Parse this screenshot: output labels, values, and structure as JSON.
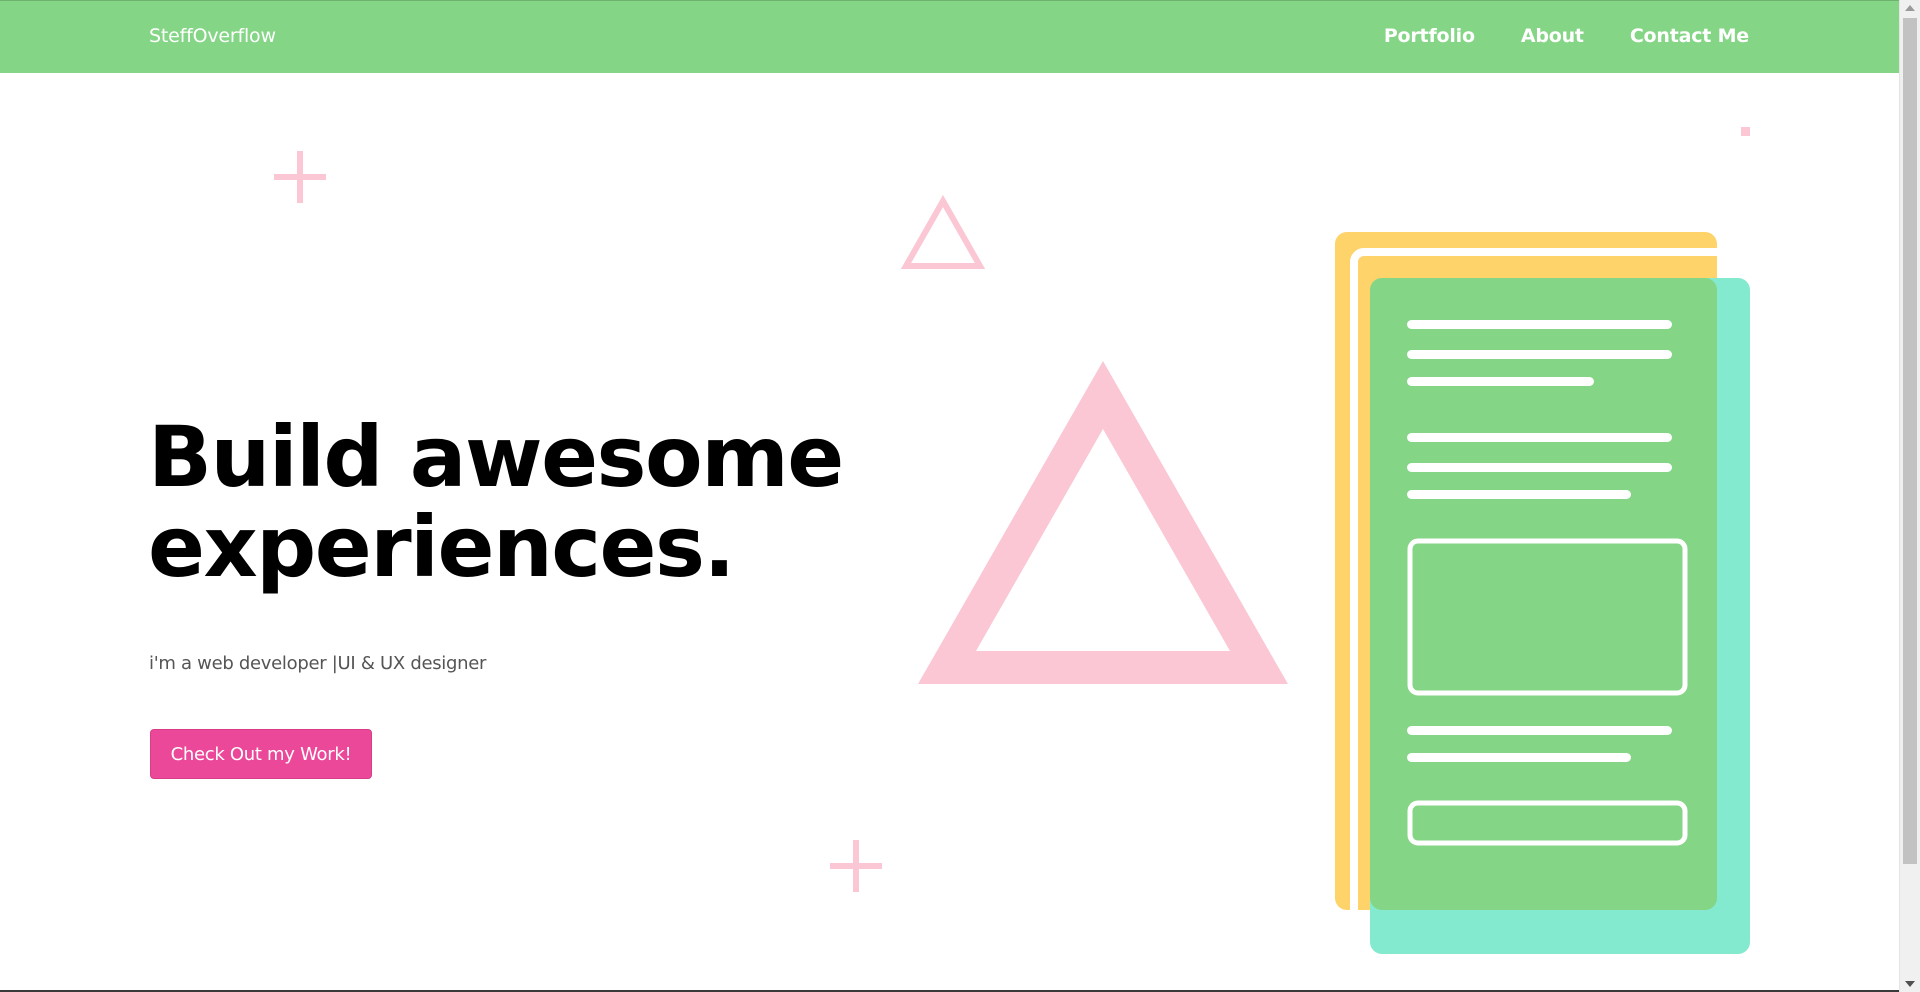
{
  "nav": {
    "brand": "SteffOverflow",
    "links": [
      {
        "label": "Portfolio"
      },
      {
        "label": "About"
      },
      {
        "label": "Contact Me"
      }
    ]
  },
  "hero": {
    "title_line1": "Build awesome",
    "title_line2": "experiences.",
    "subtitle": "i'm a web developer |UI & UX designer",
    "cta_label": "Check Out my Work!"
  },
  "colors": {
    "nav_bg": "#84d585",
    "accent_pink": "#ec4899",
    "deco_pink": "#fbc7d4",
    "card_yellow": "#fdd36a",
    "card_teal": "#83e9cf",
    "card_green": "#84d585"
  }
}
